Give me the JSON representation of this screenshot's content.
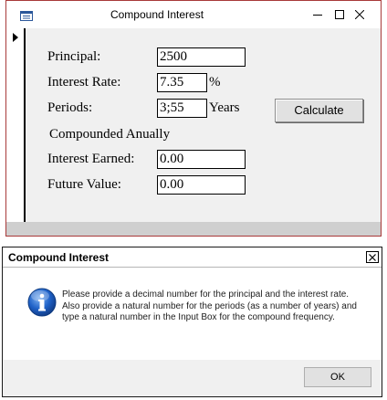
{
  "form": {
    "title": "Compound Interest",
    "fields": {
      "principal": {
        "label": "Principal:",
        "value": "2500"
      },
      "interest_rate": {
        "label": "Interest Rate:",
        "value": "7.35",
        "unit": "%"
      },
      "periods": {
        "label": "Periods:",
        "value": "3;55",
        "unit": "Years"
      },
      "interest_earned": {
        "label": "Interest Earned:",
        "value": "0.00"
      },
      "future_value": {
        "label": "Future Value:",
        "value": "0.00"
      }
    },
    "compounded_label": "Compounded Anually",
    "calculate_label": "Calculate"
  },
  "message_box": {
    "title": "Compound Interest",
    "message": "Please provide a decimal number for the principal and the interest rate. Also provide a natural number for the periods (as a number of years) and type a natural number in the Input Box for the compound frequency.",
    "ok_label": "OK",
    "icon": "info-icon"
  }
}
